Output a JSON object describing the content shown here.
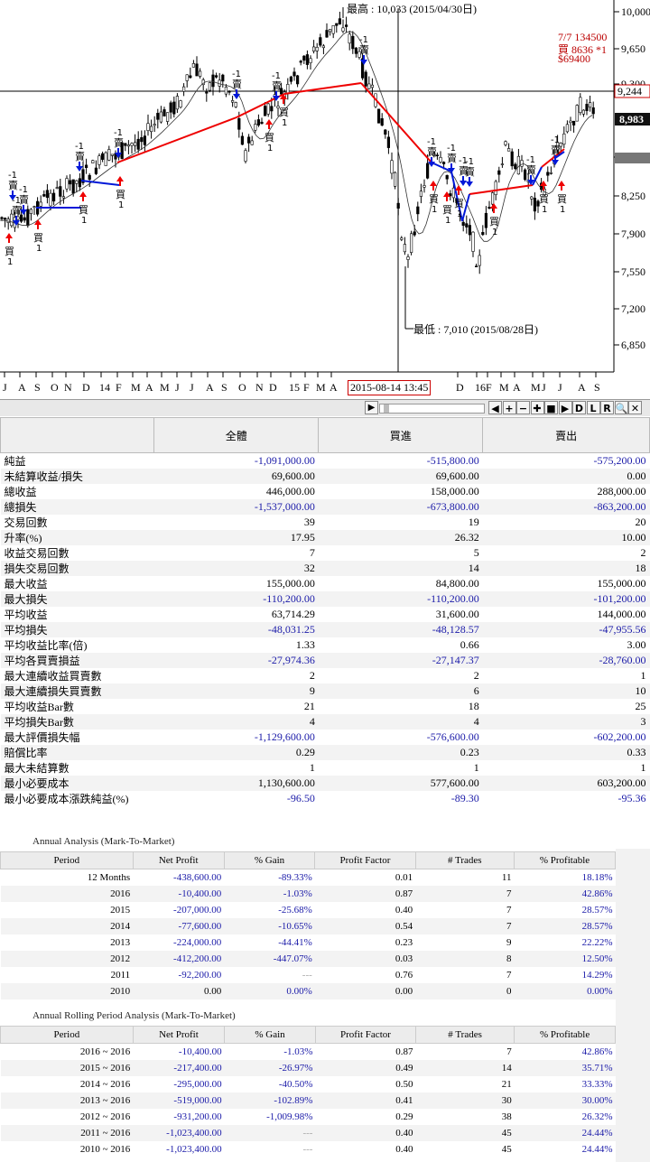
{
  "chart": {
    "y_ticks": [
      "10,000",
      "9,650",
      "9,300",
      "9,244",
      "8,983",
      "8,600",
      "8,250",
      "7,900",
      "7,550",
      "7,200",
      "6,850"
    ],
    "x_ticks": [
      "J",
      "A",
      "S",
      "O",
      "N",
      "D",
      "14",
      "F",
      "M",
      "A",
      "M",
      "J",
      "J",
      "A",
      "S",
      "O",
      "N",
      "D",
      "15",
      "F",
      "M",
      "A",
      "M",
      "D",
      "16",
      "F",
      "M",
      "A",
      "M",
      "J",
      "J",
      "A",
      "S"
    ],
    "high_label": "最高 : 10,033 (2015/04/30日)",
    "low_label": "最低 : 7,010 (2015/08/28日)",
    "cursor_date": "2015-08-14  13:45",
    "info_line1": "7/7 134500",
    "info_line2": "買 8636 *1",
    "info_line3": "$69400",
    "current_price": "8,983",
    "cross_price": "9,244",
    "signal_buy": "買",
    "signal_sell": "賣",
    "signal_plus": "1",
    "signal_minus": "-1"
  },
  "toolbar": {
    "buttons": [
      "◀",
      "+",
      "−",
      "✚",
      "■",
      "▶",
      "D",
      "L",
      "R",
      "🔍",
      "✕"
    ]
  },
  "stats": {
    "headers": [
      "",
      "全體",
      "買進",
      "賣出"
    ],
    "rows": [
      [
        "純益",
        "-1,091,000.00",
        "-515,800.00",
        "-575,200.00"
      ],
      [
        "未結算收益/損失",
        "69,600.00",
        "69,600.00",
        "0.00"
      ],
      [
        "總收益",
        "446,000.00",
        "158,000.00",
        "288,000.00"
      ],
      [
        "總損失",
        "-1,537,000.00",
        "-673,800.00",
        "-863,200.00"
      ],
      [
        "交易回數",
        "39",
        "19",
        "20"
      ],
      [
        "升率(%)",
        "17.95",
        "26.32",
        "10.00"
      ],
      [
        "收益交易回數",
        "7",
        "5",
        "2"
      ],
      [
        "損失交易回數",
        "32",
        "14",
        "18"
      ],
      [
        "最大收益",
        "155,000.00",
        "84,800.00",
        "155,000.00"
      ],
      [
        "最大損失",
        "-110,200.00",
        "-110,200.00",
        "-101,200.00"
      ],
      [
        "平均收益",
        "63,714.29",
        "31,600.00",
        "144,000.00"
      ],
      [
        "平均損失",
        "-48,031.25",
        "-48,128.57",
        "-47,955.56"
      ],
      [
        "平均收益比率(倍)",
        "1.33",
        "0.66",
        "3.00"
      ],
      [
        "平均各買賣損益",
        "-27,974.36",
        "-27,147.37",
        "-28,760.00"
      ],
      [
        "最大連續收益買賣數",
        "2",
        "2",
        "1"
      ],
      [
        "最大連續損失買賣數",
        "9",
        "6",
        "10"
      ],
      [
        "平均收益Bar數",
        "21",
        "18",
        "25"
      ],
      [
        "平均損失Bar數",
        "4",
        "4",
        "3"
      ],
      [
        "最大評價損失幅",
        "-1,129,600.00",
        "-576,600.00",
        "-602,200.00"
      ],
      [
        "賠償比率",
        "0.29",
        "0.23",
        "0.33"
      ],
      [
        "最大未結算數",
        "1",
        "1",
        "1"
      ],
      [
        "最小必要成本",
        "1,130,600.00",
        "577,600.00",
        "603,200.00"
      ],
      [
        "最小必要成本漲跌純益(%)",
        "-96.50",
        "-89.30",
        "-95.36"
      ]
    ]
  },
  "annual": {
    "title": "Annual Analysis (Mark-To-Market)",
    "headers": [
      "Period",
      "Net Profit",
      "% Gain",
      "Profit Factor",
      "# Trades",
      "% Profitable"
    ],
    "rows": [
      [
        "12 Months",
        "-438,600.00",
        "-89.33%",
        "0.01",
        "11",
        "18.18%"
      ],
      [
        "2016",
        "-10,400.00",
        "-1.03%",
        "0.87",
        "7",
        "42.86%"
      ],
      [
        "2015",
        "-207,000.00",
        "-25.68%",
        "0.40",
        "7",
        "28.57%"
      ],
      [
        "2014",
        "-77,600.00",
        "-10.65%",
        "0.54",
        "7",
        "28.57%"
      ],
      [
        "2013",
        "-224,000.00",
        "-44.41%",
        "0.23",
        "9",
        "22.22%"
      ],
      [
        "2012",
        "-412,200.00",
        "-447.07%",
        "0.03",
        "8",
        "12.50%"
      ],
      [
        "2011",
        "-92,200.00",
        "---",
        "0.76",
        "7",
        "14.29%"
      ],
      [
        "2010",
        "0.00",
        "0.00%",
        "0.00",
        "0",
        "0.00%"
      ]
    ]
  },
  "rolling": {
    "title": "Annual Rolling Period Analysis (Mark-To-Market)",
    "headers": [
      "Period",
      "Net Profit",
      "% Gain",
      "Profit Factor",
      "# Trades",
      "% Profitable"
    ],
    "rows": [
      [
        "2016 ~ 2016",
        "-10,400.00",
        "-1.03%",
        "0.87",
        "7",
        "42.86%"
      ],
      [
        "2015 ~ 2016",
        "-217,400.00",
        "-26.97%",
        "0.49",
        "14",
        "35.71%"
      ],
      [
        "2014 ~ 2016",
        "-295,000.00",
        "-40.50%",
        "0.50",
        "21",
        "33.33%"
      ],
      [
        "2013 ~ 2016",
        "-519,000.00",
        "-102.89%",
        "0.41",
        "30",
        "30.00%"
      ],
      [
        "2012 ~ 2016",
        "-931,200.00",
        "-1,009.98%",
        "0.29",
        "38",
        "26.32%"
      ],
      [
        "2011 ~ 2016",
        "-1,023,400.00",
        "---",
        "0.40",
        "45",
        "24.44%"
      ],
      [
        "2010 ~ 2016",
        "-1,023,400.00",
        "---",
        "0.40",
        "45",
        "24.44%"
      ]
    ]
  }
}
